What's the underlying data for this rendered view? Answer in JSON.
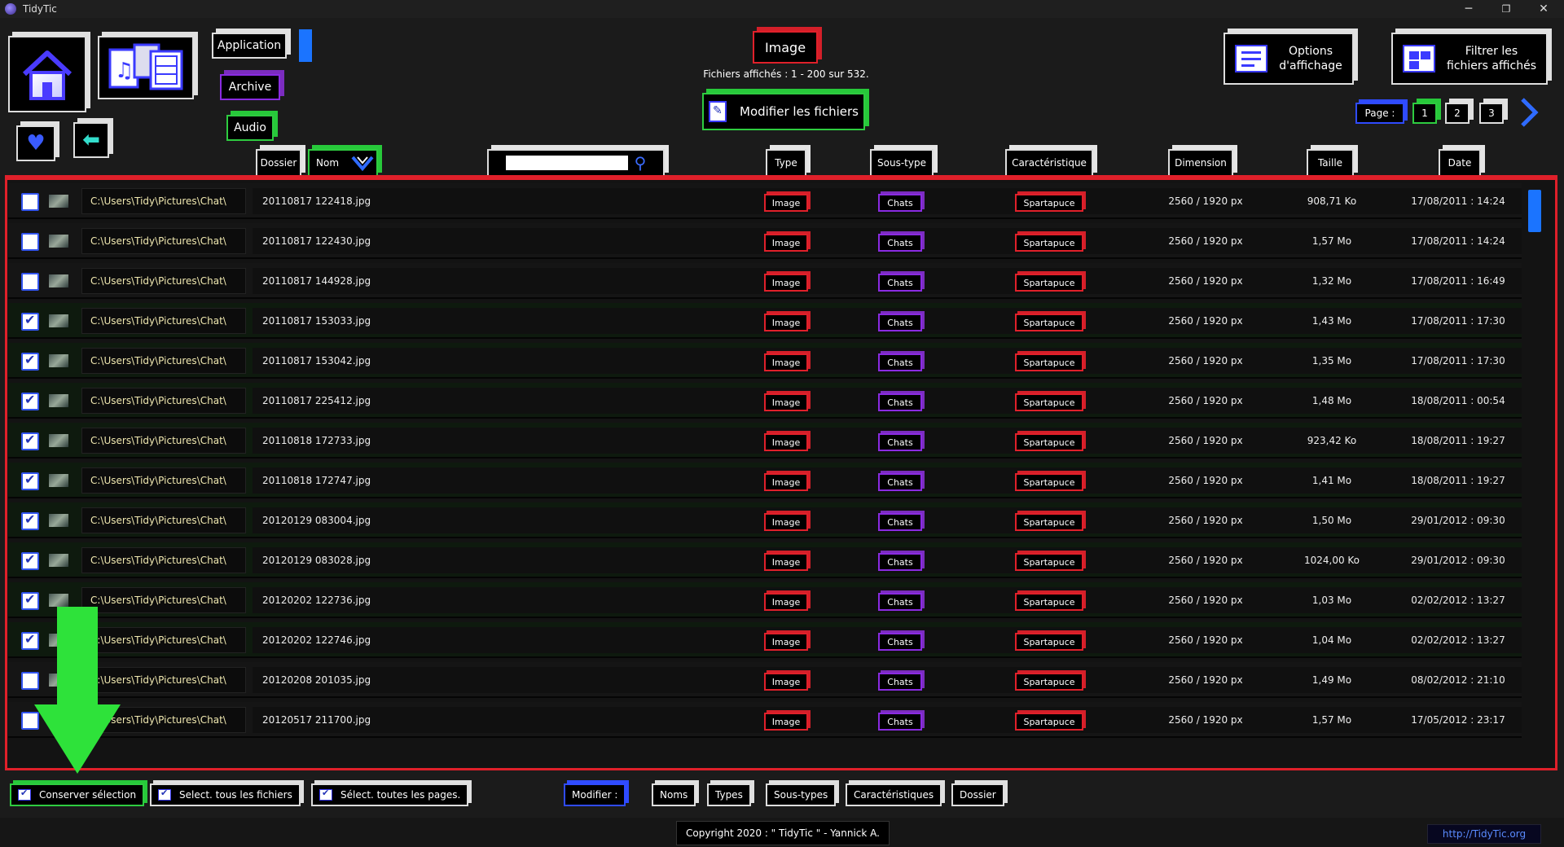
{
  "window": {
    "title": "TidyTic",
    "minimize": "─",
    "restore": "❐",
    "close": "✕"
  },
  "nav": {
    "application": "Application",
    "archive": "Archive",
    "audio": "Audio"
  },
  "header": {
    "category": "Image",
    "files_shown": "Fichiers affichés : 1 - 200 sur 532.",
    "modify_files": "Modifier les fichiers",
    "options_line1": "Options",
    "options_line2": "d'affichage",
    "filter_line1": "Filtrer les",
    "filter_line2": "fichiers affichés"
  },
  "pager": {
    "label": "Page :",
    "pages": [
      "1",
      "2",
      "3"
    ],
    "next_icon": "chevron-right-icon"
  },
  "columns": {
    "folder": "Dossier",
    "name": "Nom",
    "type": "Type",
    "subtype": "Sous-type",
    "characteristic": "Caractéristique",
    "dimension": "Dimension",
    "size": "Taille",
    "date": "Date"
  },
  "search": {
    "value": "",
    "placeholder": ""
  },
  "rows": [
    {
      "checked": false,
      "path": "C:\\Users\\Tidy\\Pictures\\Chat\\",
      "name": "20110817 122418.jpg",
      "type": "Image",
      "subtype": "Chats",
      "characteristic": "Spartapuce",
      "dimension": "2560 / 1920 px",
      "size": "908,71 Ko",
      "date": "17/08/2011 : 14:24"
    },
    {
      "checked": false,
      "path": "C:\\Users\\Tidy\\Pictures\\Chat\\",
      "name": "20110817 122430.jpg",
      "type": "Image",
      "subtype": "Chats",
      "characteristic": "Spartapuce",
      "dimension": "2560 / 1920 px",
      "size": "1,57 Mo",
      "date": "17/08/2011 : 14:24"
    },
    {
      "checked": false,
      "path": "C:\\Users\\Tidy\\Pictures\\Chat\\",
      "name": "20110817 144928.jpg",
      "type": "Image",
      "subtype": "Chats",
      "characteristic": "Spartapuce",
      "dimension": "2560 / 1920 px",
      "size": "1,32 Mo",
      "date": "17/08/2011 : 16:49"
    },
    {
      "checked": true,
      "path": "C:\\Users\\Tidy\\Pictures\\Chat\\",
      "name": "20110817 153033.jpg",
      "type": "Image",
      "subtype": "Chats",
      "characteristic": "Spartapuce",
      "dimension": "2560 / 1920 px",
      "size": "1,43 Mo",
      "date": "17/08/2011 : 17:30"
    },
    {
      "checked": true,
      "path": "C:\\Users\\Tidy\\Pictures\\Chat\\",
      "name": "20110817 153042.jpg",
      "type": "Image",
      "subtype": "Chats",
      "characteristic": "Spartapuce",
      "dimension": "2560 / 1920 px",
      "size": "1,35 Mo",
      "date": "17/08/2011 : 17:30"
    },
    {
      "checked": true,
      "path": "C:\\Users\\Tidy\\Pictures\\Chat\\",
      "name": "20110817 225412.jpg",
      "type": "Image",
      "subtype": "Chats",
      "characteristic": "Spartapuce",
      "dimension": "2560 / 1920 px",
      "size": "1,48 Mo",
      "date": "18/08/2011 : 00:54"
    },
    {
      "checked": true,
      "path": "C:\\Users\\Tidy\\Pictures\\Chat\\",
      "name": "20110818 172733.jpg",
      "type": "Image",
      "subtype": "Chats",
      "characteristic": "Spartapuce",
      "dimension": "2560 / 1920 px",
      "size": "923,42 Ko",
      "date": "18/08/2011 : 19:27"
    },
    {
      "checked": true,
      "path": "C:\\Users\\Tidy\\Pictures\\Chat\\",
      "name": "20110818 172747.jpg",
      "type": "Image",
      "subtype": "Chats",
      "characteristic": "Spartapuce",
      "dimension": "2560 / 1920 px",
      "size": "1,41 Mo",
      "date": "18/08/2011 : 19:27"
    },
    {
      "checked": true,
      "path": "C:\\Users\\Tidy\\Pictures\\Chat\\",
      "name": "20120129 083004.jpg",
      "type": "Image",
      "subtype": "Chats",
      "characteristic": "Spartapuce",
      "dimension": "2560 / 1920 px",
      "size": "1,50 Mo",
      "date": "29/01/2012 : 09:30"
    },
    {
      "checked": true,
      "path": "C:\\Users\\Tidy\\Pictures\\Chat\\",
      "name": "20120129 083028.jpg",
      "type": "Image",
      "subtype": "Chats",
      "characteristic": "Spartapuce",
      "dimension": "2560 / 1920 px",
      "size": "1024,00 Ko",
      "date": "29/01/2012 : 09:30"
    },
    {
      "checked": true,
      "path": "C:\\Users\\Tidy\\Pictures\\Chat\\",
      "name": "20120202 122736.jpg",
      "type": "Image",
      "subtype": "Chats",
      "characteristic": "Spartapuce",
      "dimension": "2560 / 1920 px",
      "size": "1,03 Mo",
      "date": "02/02/2012 : 13:27"
    },
    {
      "checked": true,
      "path": "C:\\Users\\Tidy\\Pictures\\Chat\\",
      "name": "20120202 122746.jpg",
      "type": "Image",
      "subtype": "Chats",
      "characteristic": "Spartapuce",
      "dimension": "2560 / 1920 px",
      "size": "1,04 Mo",
      "date": "02/02/2012 : 13:27"
    },
    {
      "checked": false,
      "path": "C:\\Users\\Tidy\\Pictures\\Chat\\",
      "name": "20120208 201035.jpg",
      "type": "Image",
      "subtype": "Chats",
      "characteristic": "Spartapuce",
      "dimension": "2560 / 1920 px",
      "size": "1,49 Mo",
      "date": "08/02/2012 : 21:10"
    },
    {
      "checked": false,
      "path": "C:\\Users\\Tidy\\Pictures\\Chat\\",
      "name": "20120517 211700.jpg",
      "type": "Image",
      "subtype": "Chats",
      "characteristic": "Spartapuce",
      "dimension": "2560 / 1920 px",
      "size": "1,57 Mo",
      "date": "17/05/2012 : 23:17"
    }
  ],
  "bottom": {
    "keep_selection": "Conserver sélection",
    "select_all_files": "Select. tous les fichiers",
    "select_all_pages": "Sélect. toutes les pages.",
    "modify": "Modifier :",
    "names": "Noms",
    "types": "Types",
    "subtypes": "Sous-types",
    "characteristics": "Caractéristiques",
    "folder": "Dossier"
  },
  "footer": {
    "copyright": "Copyright 2020 : \" TidyTic \" - Yannick A.",
    "site": "http://TidyTic.org"
  },
  "colors": {
    "accent_red": "#e0202a",
    "accent_green": "#2ecc40",
    "accent_purple": "#8a2be2",
    "accent_blue": "#2f4bff"
  }
}
